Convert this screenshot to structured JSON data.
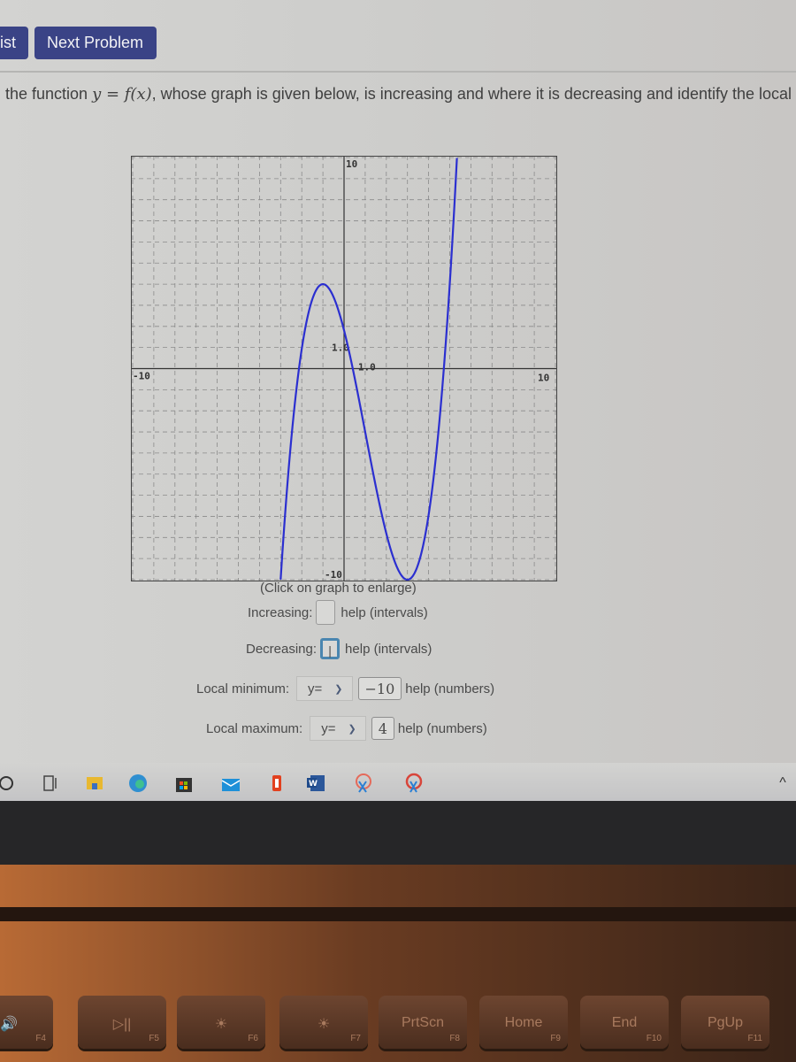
{
  "toolbar": {
    "list_button_label": "ist",
    "next_problem_label": "Next Problem"
  },
  "prompt": {
    "before": "the function ",
    "math": "y = f(x)",
    "after": ", whose graph is given below, is increasing and where it is decreasing and identify the local "
  },
  "graph": {
    "caption": "(Click on graph to enlarge)",
    "curve_color": "#2b2fd0"
  },
  "chart_data": {
    "type": "line",
    "title": "",
    "xlabel": "",
    "ylabel": "",
    "xlim": [
      -10,
      10
    ],
    "ylim": [
      -10,
      10
    ],
    "grid": true,
    "grid_step": 1,
    "tick_labels": {
      "x_min": "-10",
      "x_max": "10",
      "y_min": "-10",
      "y_max": "10",
      "x_unit": "1.0",
      "y_unit": "1.0"
    },
    "series": [
      {
        "name": "f(x)",
        "x": [
          -2.6,
          -2.4,
          -2.2,
          -2.0,
          -1.8,
          -1.6,
          -1.4,
          -1.2,
          -1.0,
          -0.8,
          -0.6,
          -0.4,
          -0.2,
          0.0,
          0.4,
          0.8,
          1.2,
          1.6,
          2.0,
          2.4,
          2.8,
          3.0,
          3.2,
          3.6,
          4.0,
          4.4,
          4.8,
          5.0,
          5.2
        ],
        "y": [
          -10.0,
          -6.9,
          -4.2,
          -1.7,
          0.2,
          1.8,
          2.9,
          3.7,
          4.0,
          3.8,
          3.4,
          2.6,
          1.6,
          0.5,
          -1.8,
          -4.2,
          -6.4,
          -8.2,
          -9.4,
          -10.0,
          -10.0,
          -10.0,
          -9.9,
          -9.0,
          -7.0,
          -3.8,
          0.5,
          3.2,
          6.5
        ]
      }
    ],
    "local_max": {
      "x": -1,
      "y": 4
    },
    "local_min": {
      "x": 3,
      "y": -10
    }
  },
  "form": {
    "increasing_label": "Increasing:",
    "increasing_value": "",
    "decreasing_label": "Decreasing:",
    "decreasing_value": "|",
    "help_intervals": "help (intervals)",
    "local_min_label": "Local minimum:",
    "local_min_select": "y=",
    "local_min_value": "−10",
    "local_max_label": "Local maximum:",
    "local_max_select": "y=",
    "local_max_value": "4",
    "help_numbers": "help (numbers)"
  },
  "taskbar": {
    "icons": [
      "search-icon",
      "task-view-icon",
      "file-explorer-icon",
      "edge-icon",
      "store-icon",
      "mail-icon",
      "office-icon",
      "word-icon",
      "snip-icon",
      "snip-sketch-icon"
    ],
    "tray_chevron": "^"
  },
  "keyboard": {
    "keys": [
      {
        "main": "🔊",
        "fn": "F4"
      },
      {
        "main": "▷||",
        "fn": "F5"
      },
      {
        "main": "☀",
        "fn": "F6"
      },
      {
        "main": "☀",
        "fn": "F7"
      },
      {
        "main": "PrtScn",
        "fn": "F8"
      },
      {
        "main": "Home",
        "fn": "F9"
      },
      {
        "main": "End",
        "fn": "F10"
      },
      {
        "main": "PgUp",
        "fn": "F11"
      }
    ]
  }
}
